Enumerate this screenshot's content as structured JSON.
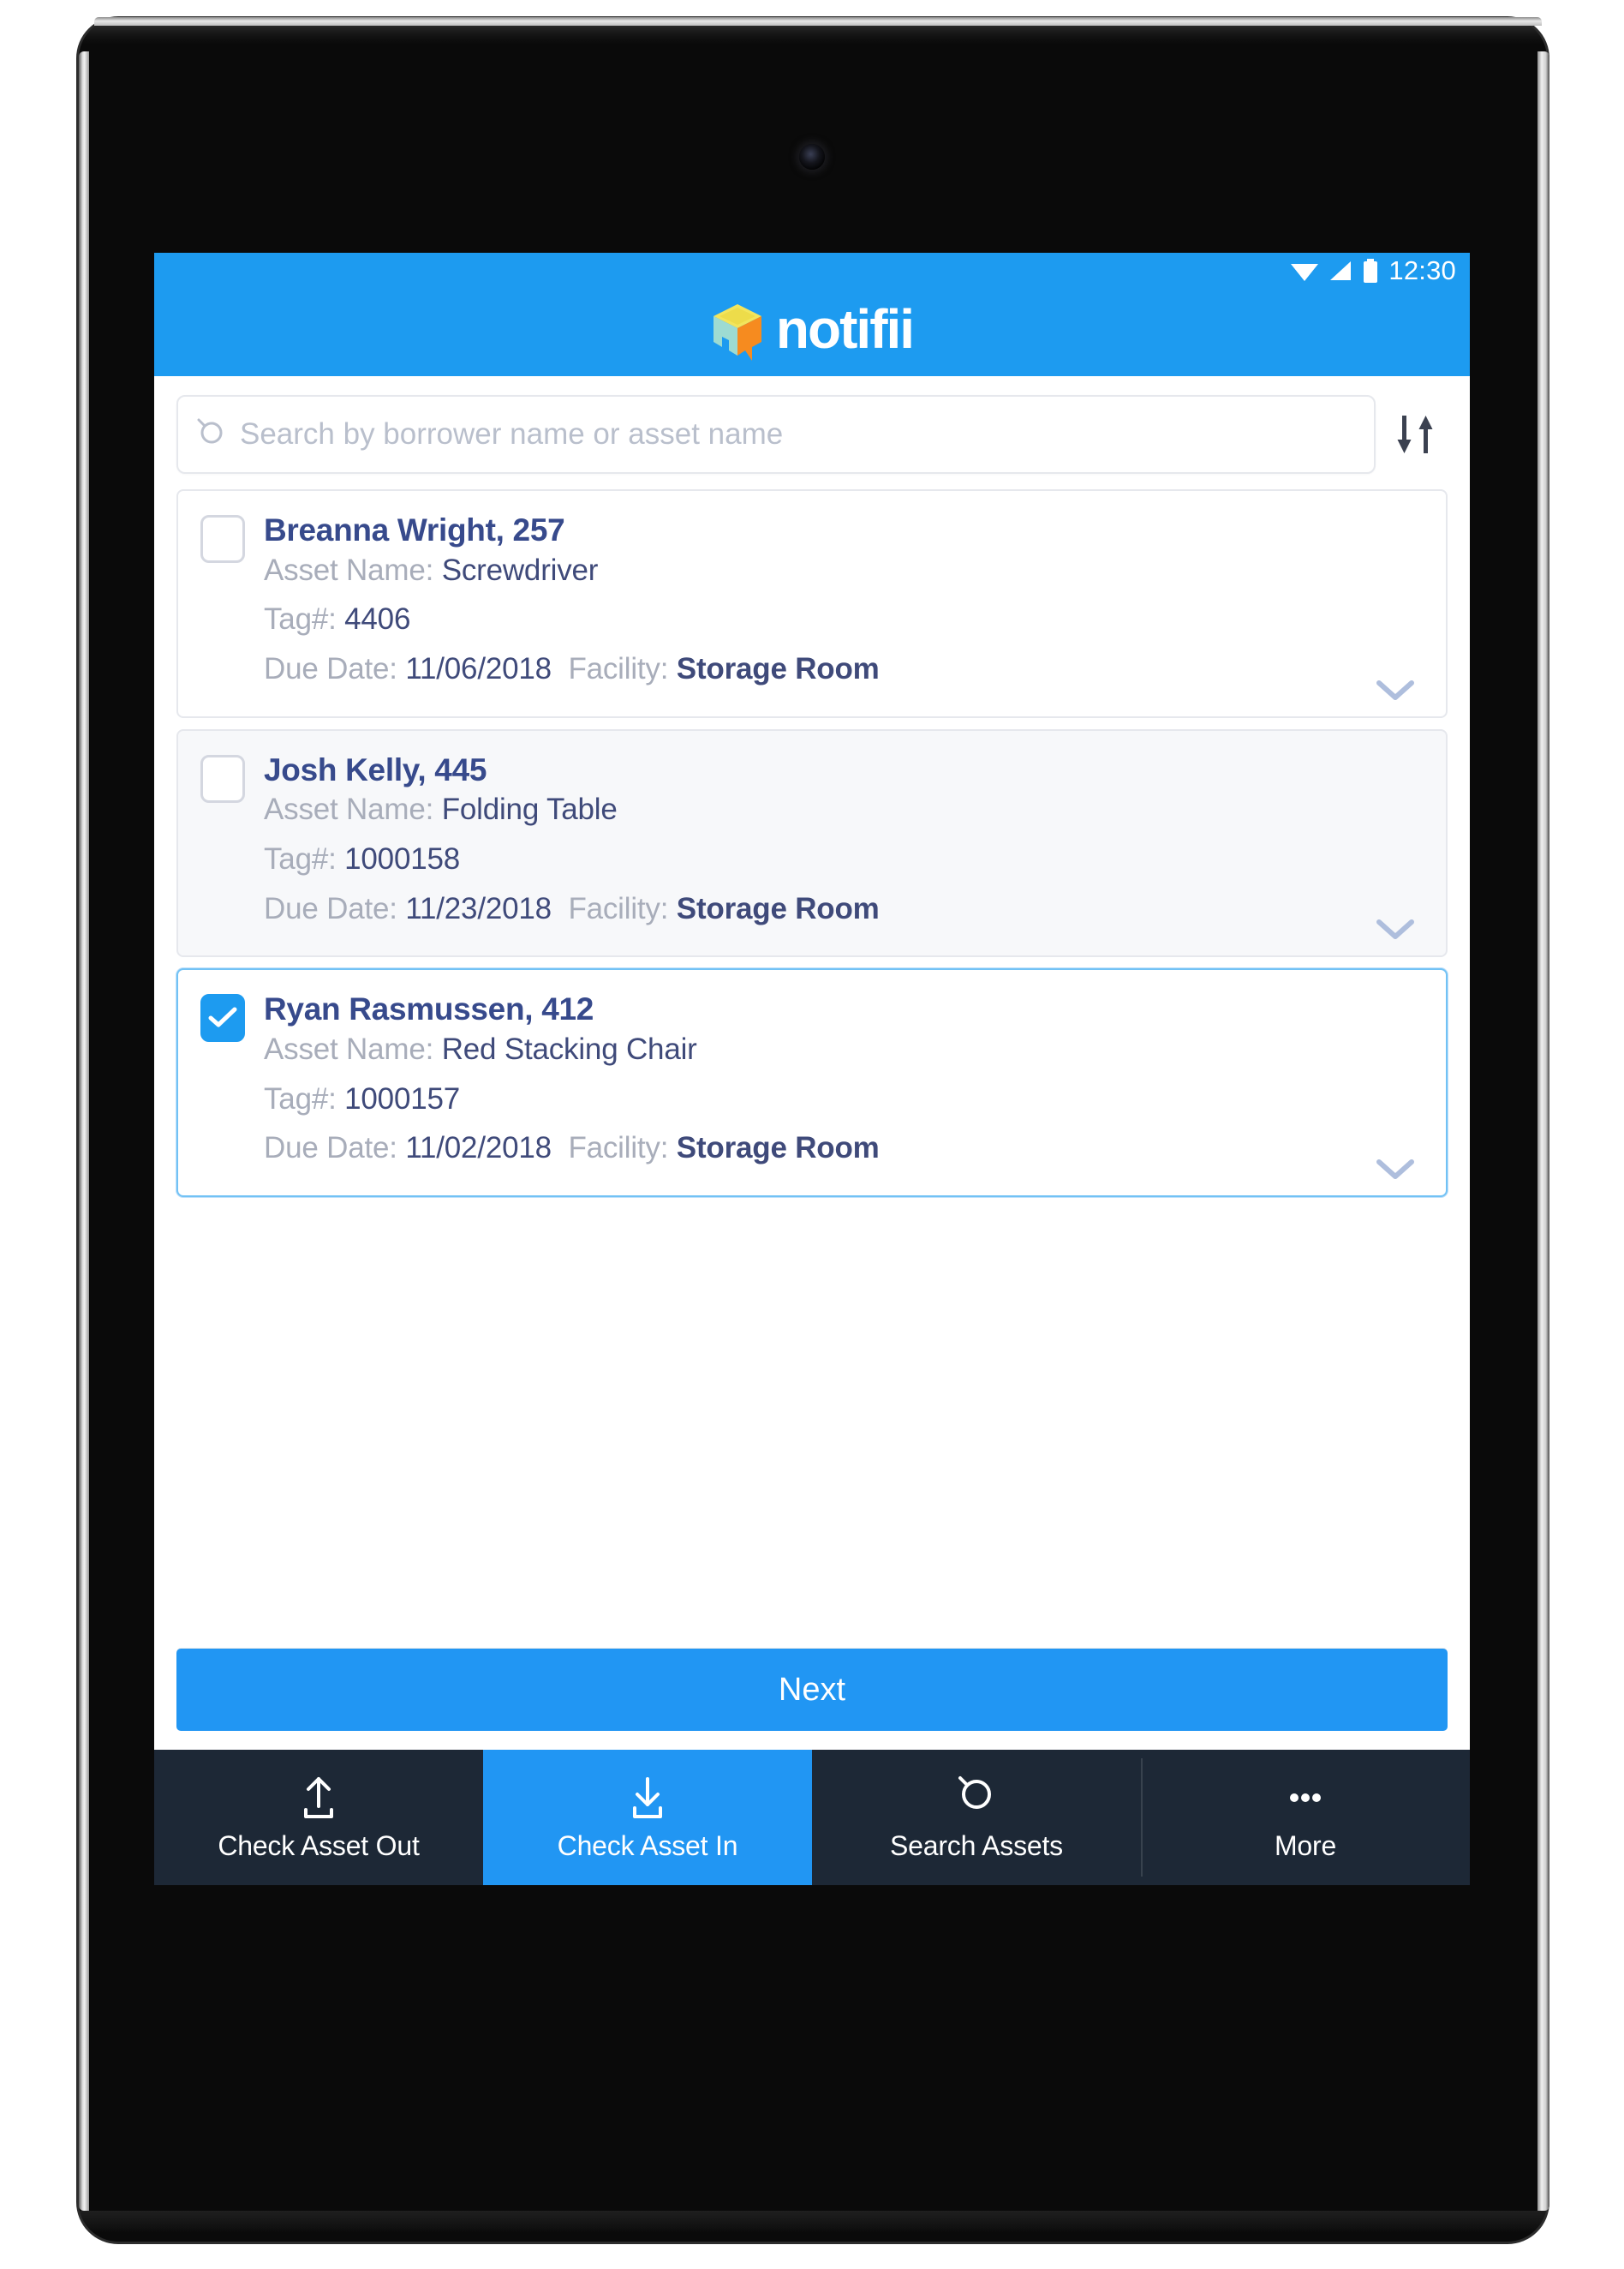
{
  "device": {
    "kind": "tablet"
  },
  "status_bar": {
    "time": "12:30",
    "icons": [
      "wifi-icon",
      "signal-icon",
      "battery-icon"
    ]
  },
  "app_bar": {
    "brand": "notifii",
    "logo_icon": "notifii-box-logo",
    "bg_color": "#1d9bf0"
  },
  "search": {
    "placeholder": "Search by borrower name or asset name",
    "value": "",
    "search_icon": "search-icon",
    "sort_icon": "sort-arrows-icon"
  },
  "labels": {
    "asset_name": "Asset Name:",
    "tag": "Tag#:",
    "due_date": "Due Date:",
    "facility": "Facility:"
  },
  "assets": [
    {
      "borrower": "Breanna Wright, 257",
      "asset_name": "Screwdriver",
      "tag": "4406",
      "due_date": "11/06/2018",
      "facility": "Storage Room",
      "selected": false
    },
    {
      "borrower": "Josh Kelly, 445",
      "asset_name": "Folding Table",
      "tag": "1000158",
      "due_date": "11/23/2018",
      "facility": "Storage Room",
      "selected": false
    },
    {
      "borrower": "Ryan Rasmussen, 412",
      "asset_name": "Red Stacking Chair",
      "tag": "1000157",
      "due_date": "11/02/2018",
      "facility": "Storage Room",
      "selected": true
    }
  ],
  "primary_action": {
    "label": "Next",
    "color": "#2196f3"
  },
  "bottom_nav": {
    "active_color": "#2196f3",
    "bg_color": "#1d2836",
    "items": [
      {
        "label": "Check Asset Out",
        "icon": "upload-icon",
        "active": false
      },
      {
        "label": "Check Asset In",
        "icon": "download-icon",
        "active": true
      },
      {
        "label": "Search Assets",
        "icon": "search-icon",
        "active": false
      },
      {
        "label": "More",
        "icon": "ellipsis-icon",
        "active": false
      }
    ]
  }
}
